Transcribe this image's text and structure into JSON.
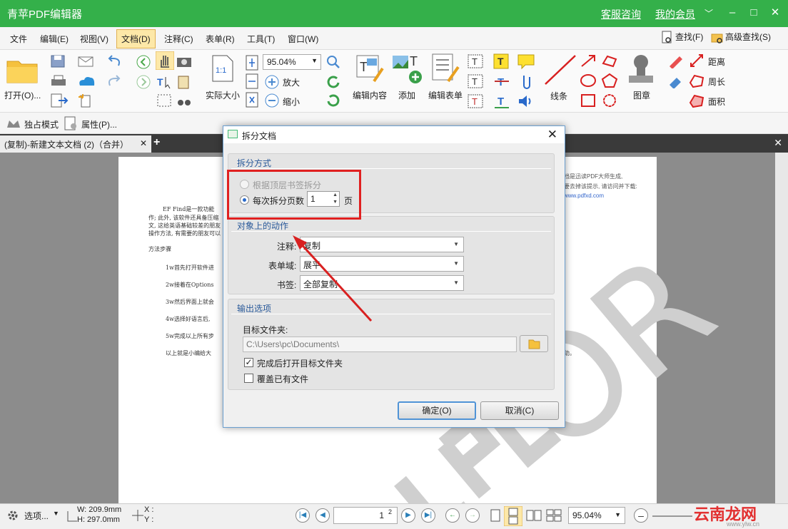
{
  "app": {
    "title": "青苹PDF编辑器",
    "service": "客服咨询",
    "member": "我的会员"
  },
  "menu": [
    "文件",
    "编辑(E)",
    "视图(V)",
    "文档(D)",
    "注释(C)",
    "表单(R)",
    "工具(T)",
    "窗口(W)"
  ],
  "menu_right": {
    "find": "查找(F)",
    "advanced_find": "高级查找(S)"
  },
  "ribbon": {
    "open": "打开(O)...",
    "actual_size": "实际大小",
    "zoom_value": "95.04%",
    "zoom_in": "放大",
    "zoom_out": "缩小",
    "edit_content": "编辑内容",
    "add": "添加",
    "edit_form": "编辑表单",
    "line": "线条",
    "stamp": "图章",
    "distance": "距离",
    "perimeter": "周长",
    "area": "面积"
  },
  "subbar": {
    "exclusive": "独占模式",
    "properties": "属性(P)..."
  },
  "tab": {
    "label": "(复制)-新建文本文档 (2)（合并）"
  },
  "document": {
    "line1": "EF Find是一款功能",
    "line2": "作; 此外, 该软件还具备压缩",
    "line3": "文, 这给英语基础较差的朋友",
    "line4": "操作方法, 有需要的朋友可以",
    "steps_title": "方法步骤",
    "step1": "1w首先打开软件进",
    "step2": "2w接着在Options",
    "step3": "3w然后界面上就会",
    "step4": "4w选择好语言后,",
    "step5": "5w完成以上所有步",
    "summary": "以上就是小编给大",
    "right1": "档是迅读PDF大师生成,",
    "right2": "要去掉该提示, 请访问并下载:",
    "right3": "www.pdfxd.com",
    "right4": "助。",
    "watermark": "OR"
  },
  "dialog": {
    "title": "拆分文档",
    "split_method": "拆分方式",
    "by_bookmark": "根据顶层书签拆分",
    "by_pages": "每次拆分页数",
    "pages_value": "1",
    "pages_unit": "页",
    "object_actions": "对象上的动作",
    "annot_label": "注释:",
    "annot_value": "复制",
    "form_label": "表单域:",
    "form_value": "展平",
    "bookmark_label": "书签:",
    "bookmark_value": "全部复制",
    "output_options": "输出选项",
    "target_folder": "目标文件夹:",
    "path": "C:\\Users\\pc\\Documents\\",
    "open_after": "完成后打开目标文件夹",
    "overwrite": "覆盖已有文件",
    "ok": "确定(O)",
    "cancel": "取消(C)"
  },
  "status": {
    "options": "选项...",
    "width": "W: 209.9mm",
    "height": "H: 297.0mm",
    "x": "X :",
    "y": "Y :",
    "page_current": "1",
    "page_total": "2",
    "zoom": "95.04%"
  },
  "overlay": {
    "logo": "云南龙网",
    "logo_sub": "www.ylw.cn"
  },
  "colors": {
    "accent": "#34b04a",
    "highlight_box": "#e02020"
  }
}
